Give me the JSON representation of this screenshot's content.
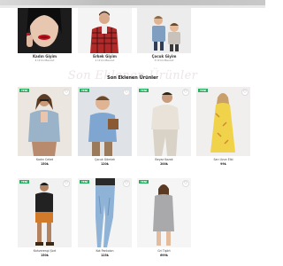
{
  "categories": [
    {
      "name": "Kadın Giyim",
      "count": "4 Ürün Mevcut"
    },
    {
      "name": "Erkek Giyim",
      "count": "1 Ürün Mevcut"
    },
    {
      "name": "Çocuk Giyim",
      "count": "3 Ürün Mevcut"
    }
  ],
  "section": {
    "background_word": "Son Eklenen Ürünler",
    "title": "Son Eklenen Ürünler"
  },
  "products": [
    {
      "name": "Kadın Ceket",
      "price": "150₺",
      "badge": "YENİ"
    },
    {
      "name": "Çocuk Gömlek",
      "price": "120₺",
      "badge": "YENİ"
    },
    {
      "name": "Beyaz Kazak",
      "price": "200₺",
      "badge": "YENİ"
    },
    {
      "name": "Sarı Uzun Elbi",
      "price": "99₺",
      "badge": "YENİ"
    },
    {
      "name": "Kahverengi Şort",
      "price": "150₺",
      "badge": "YENİ"
    },
    {
      "name": "Kot Pantolon",
      "price": "125₺",
      "badge": "YENİ"
    },
    {
      "name": "Gri Tişört",
      "price": "699₺",
      "badge": "YENİ"
    }
  ],
  "icons": {
    "heart": "heart-icon"
  },
  "colors": {
    "badge": "#27ae60",
    "watermark": "#ece6e6"
  }
}
